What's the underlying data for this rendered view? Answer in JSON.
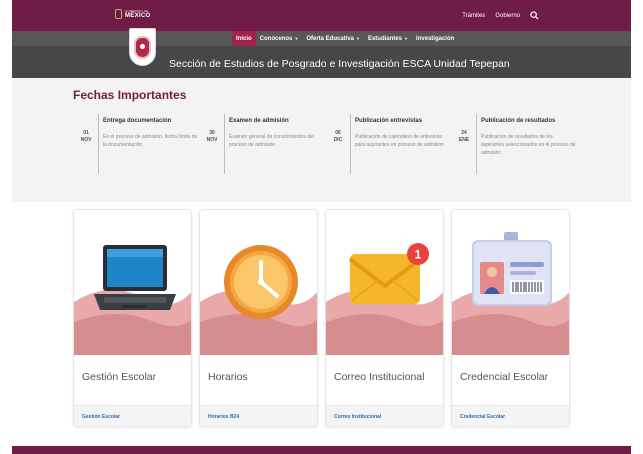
{
  "gov_bar": {
    "logo_small": "GOBIERNO DE",
    "logo_big": "MÉXICO",
    "links": [
      "Trámites",
      "Gobierno"
    ]
  },
  "nav": {
    "items": [
      {
        "label": "Inicio",
        "active": true,
        "dropdown": false
      },
      {
        "label": "Conócenos",
        "active": false,
        "dropdown": true
      },
      {
        "label": "Oferta Educativa",
        "active": false,
        "dropdown": true
      },
      {
        "label": "Estudiantes",
        "active": false,
        "dropdown": true
      },
      {
        "label": "Investigación",
        "active": false,
        "dropdown": false
      }
    ]
  },
  "site_title": "Sección de Estudios de Posgrado e Investigación ESCA Unidad Tepepan",
  "dates": {
    "title": "Fechas Importantes",
    "items": [
      {
        "day": "01",
        "month": "NOV",
        "heading": "Entrega documentación",
        "desc": "En el proceso de admisión, fecha límite de la documentación"
      },
      {
        "day": "30",
        "month": "NOV",
        "heading": "Examen de admisión",
        "desc": "Examen general de conocimientos del proceso de admisión"
      },
      {
        "day": "06",
        "month": "DIC",
        "heading": "Publicación entrevistas",
        "desc": "Publicación de calendario de entrevista para aspirantes en proceso de admisión"
      },
      {
        "day": "24",
        "month": "ENE",
        "heading": "Publicación de resultados",
        "desc": "Publicación de resultados de los aspirantes seleccionados en el proceso de admisión"
      }
    ]
  },
  "cards": [
    {
      "title": "Gestión Escolar",
      "link": "Gestión Escolar",
      "icon": "laptop-icon"
    },
    {
      "title": "Horarios",
      "link": "Horarios B24",
      "icon": "clock-icon"
    },
    {
      "title": "Correo Institucional",
      "link": "Correo Institucional",
      "icon": "mail-icon",
      "badge": "1"
    },
    {
      "title": "Credencial Escolar",
      "link": "Credencial Escolar",
      "icon": "id-card-icon"
    }
  ],
  "colors": {
    "brand": "#6f1d46",
    "nav_active": "#a0234e",
    "nav_bg": "#555758",
    "title_bg": "#454749",
    "link": "#2b6ca8"
  }
}
